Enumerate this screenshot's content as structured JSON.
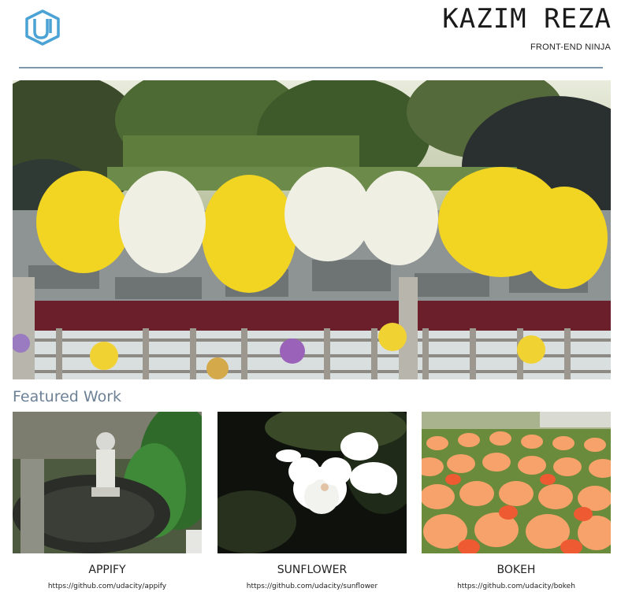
{
  "header": {
    "name": "KAZIM REZA",
    "subtitle": "FRONT-END NINJA",
    "logo_icon": "udacity-logo-icon"
  },
  "hero": {
    "image": "flower-garden-hero-image"
  },
  "featured": {
    "heading": "Featured Work",
    "projects": [
      {
        "title": "APPIFY",
        "link": "https://github.com/udacity/appify",
        "image": "fountain-statue-image"
      },
      {
        "title": "SUNFLOWER",
        "link": "https://github.com/udacity/sunflower",
        "image": "white-orchid-image"
      },
      {
        "title": "BOKEH",
        "link": "https://github.com/udacity/bokeh",
        "image": "tulip-field-image"
      }
    ]
  },
  "colors": {
    "rule": "#7d97ad",
    "heading": "#6d8196",
    "logo": "#4aa3d4"
  }
}
